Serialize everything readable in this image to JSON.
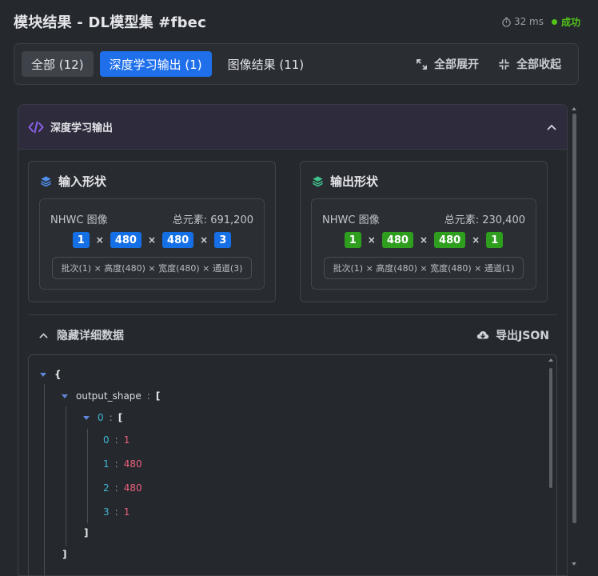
{
  "header": {
    "title": "模块结果 - DL模型集 #fbec",
    "time": "32 ms",
    "status": "成功"
  },
  "tabs": [
    {
      "label": "全部 (12)"
    },
    {
      "label": "深度学习输出 (1)"
    },
    {
      "label": "图像结果 (11)"
    }
  ],
  "actions": {
    "expand_all": "全部展开",
    "collapse_all": "全部收起"
  },
  "section": {
    "title": "深度学习输出",
    "input": {
      "title": "输入形状",
      "format": "NHWC 图像",
      "total": "总元素: 691,200",
      "dims": [
        "1",
        "480",
        "480",
        "3"
      ],
      "desc": "批次(1) × 高度(480) × 宽度(480) × 通道(3)"
    },
    "output": {
      "title": "输出形状",
      "format": "NHWC 图像",
      "total": "总元素: 230,400",
      "dims": [
        "1",
        "480",
        "480",
        "1"
      ],
      "desc": "批次(1) × 高度(480) × 宽度(480) × 通道(1)"
    },
    "times_symbol": "×",
    "detail_toggle": "隐藏详细数据",
    "export": "导出JSON"
  },
  "json": {
    "open_brace": "{",
    "key_output_shape": "output_shape",
    "colon": ":",
    "open_bracket": "[",
    "close_bracket": "]",
    "index0": "0",
    "items": [
      {
        "index": "0",
        "value": "1"
      },
      {
        "index": "1",
        "value": "480"
      },
      {
        "index": "2",
        "value": "480"
      },
      {
        "index": "3",
        "value": "1"
      }
    ]
  },
  "colors": {
    "accent": "#1f6feb",
    "success": "#52c41a",
    "blue_chip": "#1570e6",
    "green_chip": "#2f9e1f",
    "number": "#ee5f7c",
    "index": "#3fb6d4"
  },
  "icons": [
    "timer-icon",
    "expand-icon",
    "collapse-icon",
    "code-icon",
    "chevron-up-icon",
    "layers-icon",
    "cloud-download-icon",
    "caret-down-icon"
  ]
}
